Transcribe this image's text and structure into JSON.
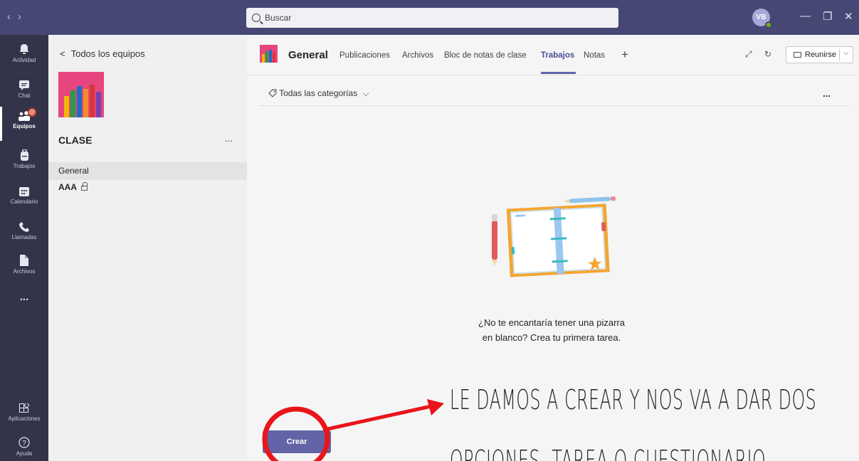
{
  "titlebar": {
    "search_placeholder": "Buscar",
    "avatar_initials": "VB",
    "back_arrow": "‹",
    "forward_arrow": "›",
    "minimize": "—",
    "maximize": "❐",
    "close": "✕"
  },
  "rail": {
    "items": [
      {
        "label": "Actividad",
        "icon": "bell-icon"
      },
      {
        "label": "Chat",
        "icon": "chat-icon"
      },
      {
        "label": "Equipos",
        "icon": "teams-icon",
        "badge": "@"
      },
      {
        "label": "Trabajos",
        "icon": "backpack-icon"
      },
      {
        "label": "Calendario",
        "icon": "calendar-icon"
      },
      {
        "label": "Llamadas",
        "icon": "phone-icon"
      },
      {
        "label": "Archivos",
        "icon": "file-icon"
      },
      {
        "label": "...",
        "icon": "more-icon"
      }
    ],
    "bottom": [
      {
        "label": "Aplicaciones",
        "icon": "apps-icon"
      },
      {
        "label": "Ayuda",
        "icon": "help-icon"
      }
    ]
  },
  "team_pane": {
    "back_label": "Todos los equipos",
    "team_name": "CLASE",
    "more": "...",
    "channels": [
      {
        "name": "General",
        "selected": true
      },
      {
        "name": "AAA",
        "private": true
      }
    ]
  },
  "header": {
    "channel_name": "General",
    "tabs": [
      "Publicaciones",
      "Archivos",
      "Bloc de notas de clase",
      "Trabajos",
      "Notas"
    ],
    "active_tab": "Trabajos",
    "add_tab": "+",
    "meet_label": "Reunirse"
  },
  "assignments": {
    "filter_label": "Todas las categorías",
    "more": "...",
    "empty_line1": "¿No te encantaría tener una pizarra",
    "empty_line2": "en blanco? Crea tu primera tarea.",
    "create_label": "Crear"
  },
  "annotation": {
    "line1": "LE DAMOS A CREAR Y NOS VA A DAR DOS",
    "line2": "OPCIONES, TAREA O CUESTIONARIO",
    "colors": {
      "marker": "#e8151b"
    }
  },
  "colors": {
    "titlebar": "#464775",
    "rail": "#33344a",
    "accent": "#6264a7",
    "team_tile": "#e6457e"
  }
}
